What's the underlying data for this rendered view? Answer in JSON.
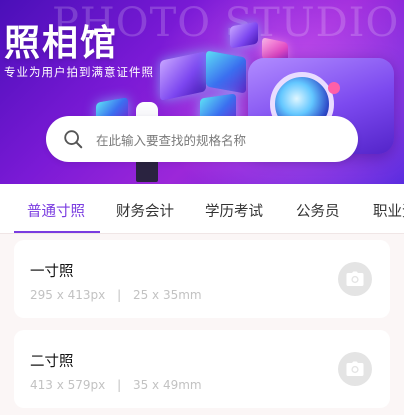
{
  "banner": {
    "watermark": "PHOTO STUDIO",
    "title": "照相馆",
    "subtitle": "专业为用户拍到满意证件照"
  },
  "search": {
    "placeholder": "在此输入要查找的规格名称",
    "icon": "search-icon"
  },
  "tabs": [
    {
      "label": "普通寸照",
      "active": true
    },
    {
      "label": "财务会计",
      "active": false
    },
    {
      "label": "学历考试",
      "active": false
    },
    {
      "label": "公务员",
      "active": false
    },
    {
      "label": "职业资格",
      "active": false
    }
  ],
  "items": [
    {
      "title": "一寸照",
      "pixels": "295 x 413px",
      "separator": "|",
      "size": "25 x 35mm",
      "icon": "camera-icon"
    },
    {
      "title": "二寸照",
      "pixels": "413 x 579px",
      "separator": "|",
      "size": "35 x 49mm",
      "icon": "camera-icon"
    }
  ],
  "colors": {
    "accent": "#7a3ce0",
    "banner_from": "#4a0fb8",
    "banner_to": "#9c27d9",
    "list_background": "#fbf6f6",
    "camera_button": "#e4e4e4"
  }
}
